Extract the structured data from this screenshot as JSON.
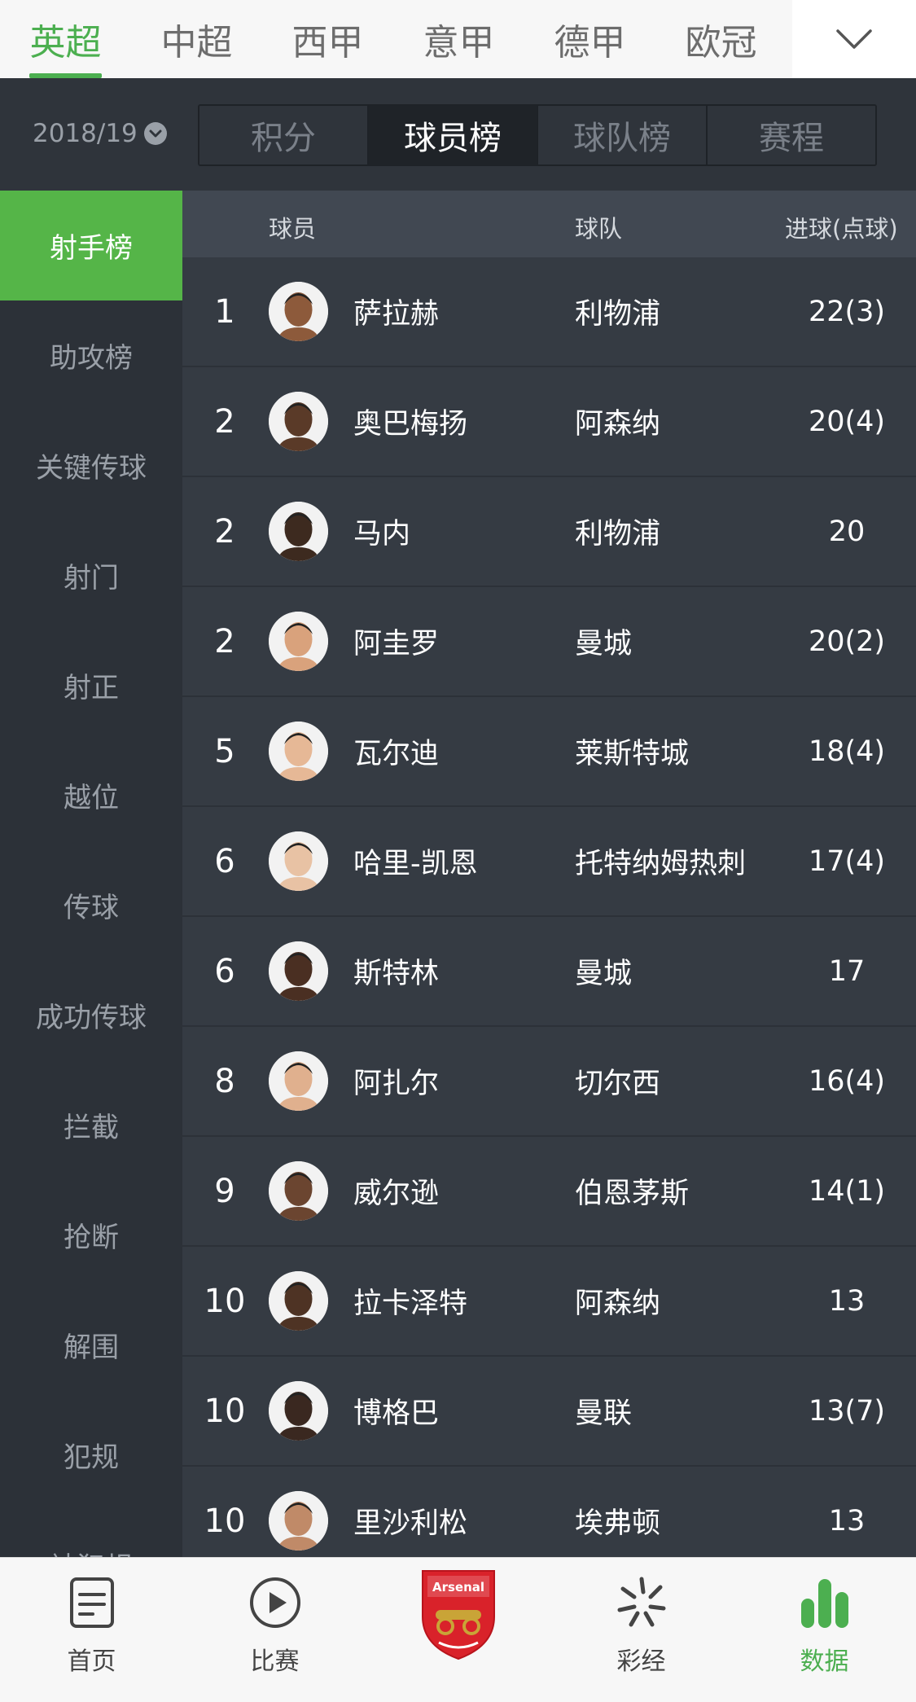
{
  "leagues": {
    "tabs": [
      "英超",
      "中超",
      "西甲",
      "意甲",
      "德甲",
      "欧冠"
    ],
    "active_index": 0
  },
  "season": {
    "label": "2018/19",
    "chevron_icon": "chevron-down-circle-icon"
  },
  "segments": {
    "items": [
      "积分",
      "球员榜",
      "球队榜",
      "赛程"
    ],
    "active_index": 1
  },
  "sidebar": {
    "items": [
      "射手榜",
      "助攻榜",
      "关键传球",
      "射门",
      "射正",
      "越位",
      "传球",
      "成功传球",
      "拦截",
      "抢断",
      "解围",
      "犯规",
      "被犯规"
    ],
    "active_index": 0
  },
  "table": {
    "headers": {
      "player": "球员",
      "team": "球队",
      "goals": "进球(点球)"
    },
    "rows": [
      {
        "rank": "1",
        "player": "萨拉赫",
        "team": "利物浦",
        "goals": "22(3)"
      },
      {
        "rank": "2",
        "player": "奥巴梅扬",
        "team": "阿森纳",
        "goals": "20(4)"
      },
      {
        "rank": "2",
        "player": "马内",
        "team": "利物浦",
        "goals": "20"
      },
      {
        "rank": "2",
        "player": "阿圭罗",
        "team": "曼城",
        "goals": "20(2)"
      },
      {
        "rank": "5",
        "player": "瓦尔迪",
        "team": "莱斯特城",
        "goals": "18(4)"
      },
      {
        "rank": "6",
        "player": "哈里-凯恩",
        "team": "托特纳姆热刺",
        "goals": "17(4)"
      },
      {
        "rank": "6",
        "player": "斯特林",
        "team": "曼城",
        "goals": "17"
      },
      {
        "rank": "8",
        "player": "阿扎尔",
        "team": "切尔西",
        "goals": "16(4)"
      },
      {
        "rank": "9",
        "player": "威尔逊",
        "team": "伯恩茅斯",
        "goals": "14(1)"
      },
      {
        "rank": "10",
        "player": "拉卡泽特",
        "team": "阿森纳",
        "goals": "13"
      },
      {
        "rank": "10",
        "player": "博格巴",
        "team": "曼联",
        "goals": "13(7)"
      },
      {
        "rank": "10",
        "player": "里沙利松",
        "team": "埃弗顿",
        "goals": "13"
      }
    ]
  },
  "bottom_nav": {
    "items": [
      {
        "label": "首页",
        "icon": "document-icon"
      },
      {
        "label": "比赛",
        "icon": "play-circle-icon"
      },
      {
        "label": "",
        "icon": "arsenal-crest-icon"
      },
      {
        "label": "彩经",
        "icon": "spark-icon"
      },
      {
        "label": "数据",
        "icon": "bar-chart-icon"
      }
    ],
    "active_index": 4
  },
  "colors": {
    "accent": "#4caf50",
    "sidebar_active": "#55b548",
    "background": "#2c3138",
    "row": "#353b43",
    "header": "#414852"
  }
}
